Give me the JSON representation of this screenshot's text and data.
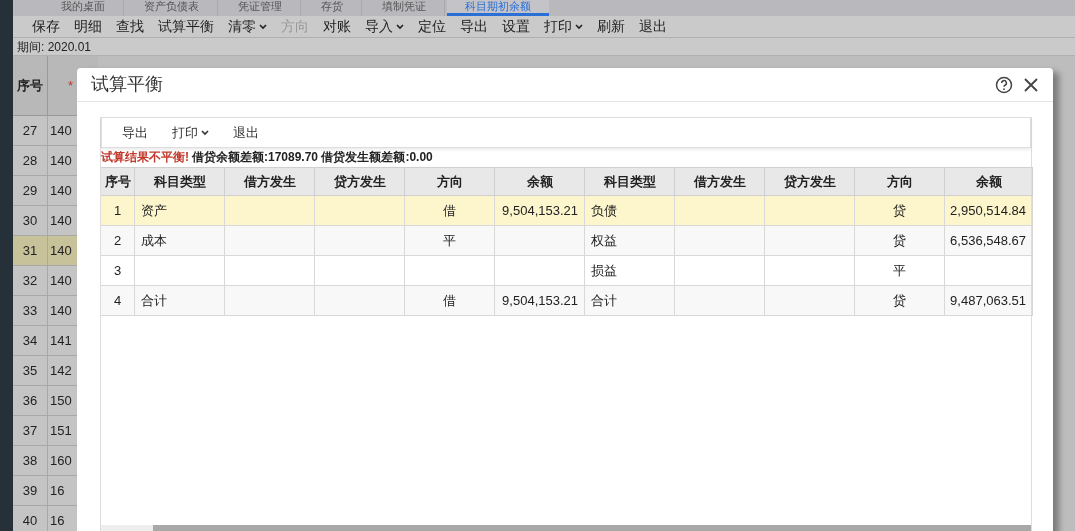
{
  "tabs": [
    {
      "label": "我的桌面",
      "selected": false
    },
    {
      "label": "资产负债表",
      "selected": false
    },
    {
      "label": "凭证管理",
      "selected": false
    },
    {
      "label": "存货",
      "selected": false
    },
    {
      "label": "填制凭证",
      "selected": false
    },
    {
      "label": "科目期初余额",
      "selected": true
    }
  ],
  "toolbar": [
    {
      "label": "保存",
      "dropdown": false,
      "disabled": false
    },
    {
      "label": "明细",
      "dropdown": false,
      "disabled": false
    },
    {
      "label": "查找",
      "dropdown": false,
      "disabled": false
    },
    {
      "label": "试算平衡",
      "dropdown": false,
      "disabled": false
    },
    {
      "label": "清零",
      "dropdown": true,
      "disabled": false
    },
    {
      "label": "方向",
      "dropdown": false,
      "disabled": true
    },
    {
      "label": "对账",
      "dropdown": false,
      "disabled": false
    },
    {
      "label": "导入",
      "dropdown": true,
      "disabled": false
    },
    {
      "label": "定位",
      "dropdown": false,
      "disabled": false
    },
    {
      "label": "导出",
      "dropdown": false,
      "disabled": false
    },
    {
      "label": "设置",
      "dropdown": false,
      "disabled": false
    },
    {
      "label": "打印",
      "dropdown": true,
      "disabled": false
    },
    {
      "label": "刷新",
      "dropdown": false,
      "disabled": false
    },
    {
      "label": "退出",
      "dropdown": false,
      "disabled": false
    }
  ],
  "period": "期间: 2020.01",
  "grid": {
    "header": {
      "column_1": "序号",
      "column_2_mark": "*"
    },
    "rows": [
      {
        "no": "27",
        "code": "140",
        "selected": false
      },
      {
        "no": "28",
        "code": "140",
        "selected": false
      },
      {
        "no": "29",
        "code": "140",
        "selected": false
      },
      {
        "no": "30",
        "code": "140",
        "selected": false
      },
      {
        "no": "31",
        "code": "140",
        "selected": true
      },
      {
        "no": "32",
        "code": "140",
        "selected": false
      },
      {
        "no": "33",
        "code": "140",
        "selected": false
      },
      {
        "no": "34",
        "code": "141",
        "selected": false
      },
      {
        "no": "35",
        "code": "142",
        "selected": false
      },
      {
        "no": "36",
        "code": "150",
        "selected": false
      },
      {
        "no": "37",
        "code": "151",
        "selected": false
      },
      {
        "no": "38",
        "code": "160",
        "selected": false
      },
      {
        "no": "39",
        "code": "16",
        "selected": false
      },
      {
        "no": "40",
        "code": "16",
        "selected": false
      }
    ]
  },
  "dialog": {
    "title": "试算平衡",
    "toolbar": [
      {
        "label": "导出",
        "dropdown": false
      },
      {
        "label": "打印",
        "dropdown": true
      },
      {
        "label": "退出",
        "dropdown": false
      }
    ],
    "message": {
      "status": "试算结果不平衡!",
      "detail": "借贷余额差额:17089.70 借贷发生额差额:0.00"
    },
    "table": {
      "columns": [
        "序号",
        "科目类型",
        "借方发生",
        "贷方发生",
        "方向",
        "余额",
        "科目类型",
        "借方发生",
        "贷方发生",
        "方向",
        "余额"
      ],
      "rows": [
        {
          "selected": true,
          "cells": [
            "1",
            "资产",
            "",
            "",
            "借",
            "9,504,153.21",
            "负债",
            "",
            "",
            "贷",
            "2,950,514.84"
          ]
        },
        {
          "selected": false,
          "cells": [
            "2",
            "成本",
            "",
            "",
            "平",
            "",
            "权益",
            "",
            "",
            "贷",
            "6,536,548.67"
          ]
        },
        {
          "selected": false,
          "cells": [
            "3",
            "",
            "",
            "",
            "",
            "",
            "损益",
            "",
            "",
            "平",
            ""
          ]
        },
        {
          "selected": false,
          "cells": [
            "4",
            "合计",
            "",
            "",
            "借",
            "9,504,153.21",
            "合计",
            "",
            "",
            "贷",
            "9,487,063.51"
          ]
        }
      ]
    }
  }
}
